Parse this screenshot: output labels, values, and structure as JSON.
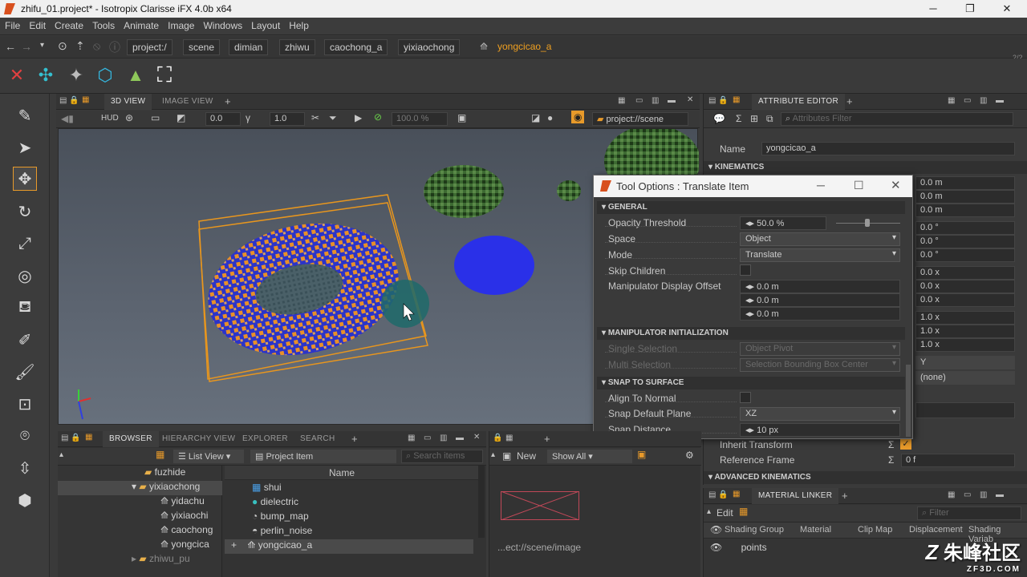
{
  "window": {
    "title": "zhifu_01.project* - Isotropix Clarisse iFX 4.0b x64"
  },
  "menu": [
    "File",
    "Edit",
    "Create",
    "Tools",
    "Animate",
    "Image",
    "Windows",
    "Layout",
    "Help"
  ],
  "breadcrumb": [
    "project:/",
    "scene",
    "dimian",
    "zhiwu",
    "caochong_a",
    "yixiaochong"
  ],
  "breadcrumb_current": "yongcicao_a",
  "page_counter": "2/2",
  "viewport": {
    "tabs": [
      "3D VIEW",
      "IMAGE VIEW"
    ],
    "hud_label": "HUD",
    "field1": "0.0",
    "field2": "1.0",
    "zoom": "100.0 %",
    "context_path": "project://scene"
  },
  "attribute_editor": {
    "tab": "ATTRIBUTE EDITOR",
    "filter_placeholder": "Attributes Filter",
    "name_label": "Name",
    "name_value": "yongcicao_a",
    "kinematics": "KINEMATICS",
    "translate": [
      "0.0 m",
      "0.0 m",
      "0.0 m"
    ],
    "rotate": [
      "0.0 °",
      "0.0 °",
      "0.0 °"
    ],
    "offset": [
      "0.0 x",
      "0.0 x",
      "0.0 x"
    ],
    "scale": [
      "1.0 x",
      "1.0 x",
      "1.0 x"
    ],
    "y_value": "Y",
    "none_value": "(none)",
    "inherit_transform": "Inherit Transform",
    "reference_frame": "Reference Frame",
    "reference_frame_value": "0 f",
    "advanced_kinematics": "ADVANCED KINEMATICS"
  },
  "tool_options": {
    "title": "Tool Options : Translate Item",
    "general": "GENERAL",
    "opacity_threshold": "Opacity Threshold",
    "opacity_value": "50.0 %",
    "space": "Space",
    "space_value": "Object",
    "mode": "Mode",
    "mode_value": "Translate",
    "skip_children": "Skip Children",
    "manip_offset": "Manipulator Display Offset",
    "offset_values": [
      "0.0 m",
      "0.0 m",
      "0.0 m"
    ],
    "manip_init": "MANIPULATOR INITIALIZATION",
    "single_selection": "Single Selection",
    "single_value": "Object Pivot",
    "multi_selection": "Multi Selection",
    "multi_value": "Selection Bounding Box Center",
    "snap_surface": "SNAP TO SURFACE",
    "align_normal": "Align To Normal",
    "snap_plane": "Snap Default Plane",
    "snap_plane_value": "XZ",
    "snap_distance": "Snap Distance",
    "snap_distance_value": "10 px"
  },
  "browser": {
    "tabs": [
      "BROWSER",
      "HIERARCHY VIEW",
      "EXPLORER",
      "SEARCH"
    ],
    "list_view": "List View",
    "project_item": "Project Item",
    "search_placeholder": "Search items",
    "column_name": "Name",
    "tree": [
      "fuzhide",
      "yixiaochong",
      "yidachu",
      "yixiaochi",
      "caochong",
      "yongcica",
      "zhiwu_pu"
    ],
    "items": [
      "shui",
      "dielectric",
      "bump_map",
      "perlin_noise",
      "yongcicao_a"
    ]
  },
  "image_panel": {
    "new": "New",
    "show": "Show All",
    "path": "...ect://scene/image"
  },
  "material_linker": {
    "tab": "MATERIAL LINKER",
    "edit": "Edit",
    "filter_placeholder": "Filter",
    "columns": [
      "Shading Group",
      "Material",
      "Clip Map",
      "Displacement",
      "Shading Variab"
    ],
    "row": "points"
  },
  "watermark": {
    "text": "朱峰社区",
    "sub": "ZF3D.COM"
  }
}
